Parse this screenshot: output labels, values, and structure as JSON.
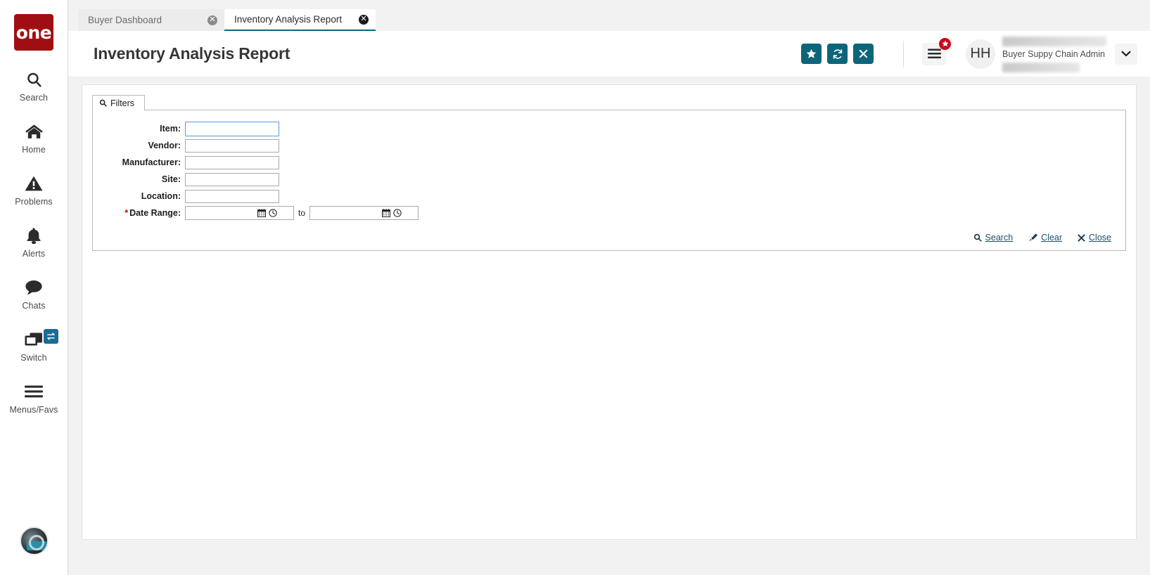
{
  "brand": {
    "logo_text": "one",
    "logo_color": "#a10e12",
    "accent_color": "#0d6579"
  },
  "sidebar": {
    "items": [
      {
        "label": "Search",
        "icon": "search-icon"
      },
      {
        "label": "Home",
        "icon": "home-icon"
      },
      {
        "label": "Problems",
        "icon": "warning-triangle-icon"
      },
      {
        "label": "Alerts",
        "icon": "bell-icon"
      },
      {
        "label": "Chats",
        "icon": "chat-bubble-icon"
      },
      {
        "label": "Switch",
        "icon": "windows-stack-icon",
        "badge_icon": "swap-arrows-icon"
      },
      {
        "label": "Menus/Favs",
        "icon": "hamburger-icon"
      }
    ],
    "profile_avatar": "user-photo-avatar"
  },
  "tabs": [
    {
      "label": "Buyer Dashboard",
      "active": false,
      "close_icon": "close-circle-icon"
    },
    {
      "label": "Inventory Analysis Report",
      "active": true,
      "close_icon": "close-circle-icon"
    }
  ],
  "header": {
    "title": "Inventory Analysis Report",
    "buttons": [
      {
        "name": "favorite-button",
        "icon": "star-icon"
      },
      {
        "name": "refresh-button",
        "icon": "refresh-icon"
      },
      {
        "name": "close-button",
        "icon": "x-icon"
      }
    ],
    "menu_button": {
      "icon": "hamburger-icon",
      "badge_icon": "star-icon"
    },
    "avatar_initials": "HH",
    "user_role": "Buyer Suppy Chain Admin",
    "dropdown_icon": "chevron-down-icon"
  },
  "filters": {
    "tab_label": "Filters",
    "tab_icon": "search-icon",
    "fields": [
      {
        "label": "Item:",
        "value": "",
        "placeholder": "",
        "required": false,
        "focused": true
      },
      {
        "label": "Vendor:",
        "value": "",
        "placeholder": "",
        "required": false,
        "focused": false
      },
      {
        "label": "Manufacturer:",
        "value": "",
        "placeholder": "",
        "required": false,
        "focused": false
      },
      {
        "label": "Site:",
        "value": "",
        "placeholder": "",
        "required": false,
        "focused": false
      },
      {
        "label": "Location:",
        "value": "",
        "placeholder": "",
        "required": false,
        "focused": false
      }
    ],
    "date_range": {
      "label": "Date Range:",
      "required_marker": "*",
      "from_value": "",
      "to_value": "",
      "separator": "to",
      "calendar_icon": "calendar-icon",
      "clock_icon": "clock-icon"
    },
    "actions": [
      {
        "label": "Search",
        "icon": "search-icon"
      },
      {
        "label": "Clear",
        "icon": "eraser-icon"
      },
      {
        "label": "Close",
        "icon": "x-icon"
      }
    ]
  }
}
